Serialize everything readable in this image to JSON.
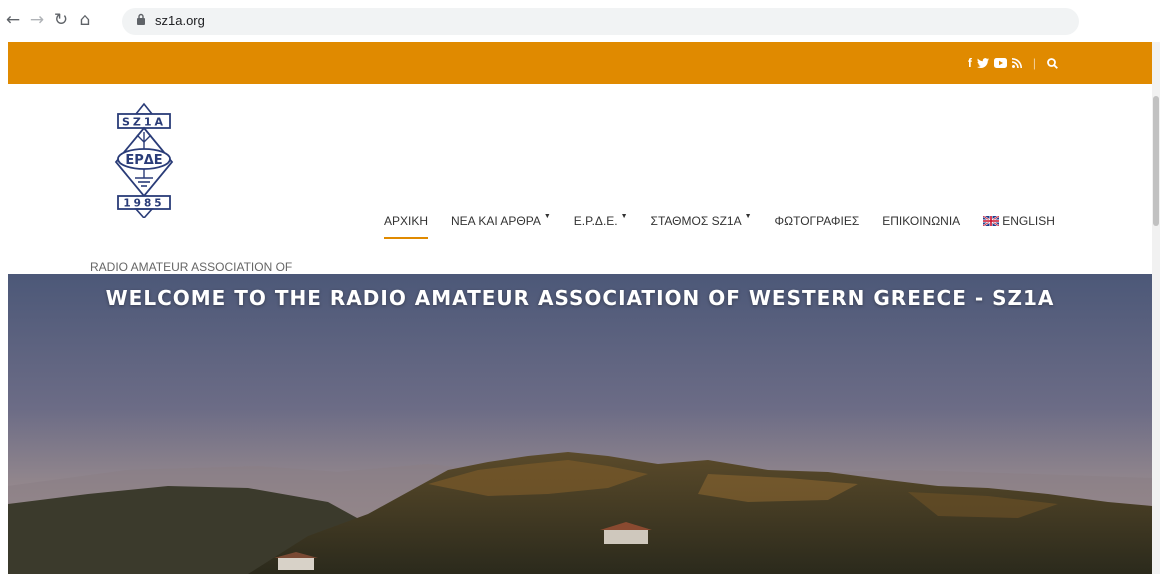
{
  "browser": {
    "url": "sz1a.org"
  },
  "topbar": {
    "social_icons": [
      "facebook-icon",
      "twitter-icon",
      "youtube-icon",
      "rss-icon"
    ],
    "social_glyphs": {
      "facebook": "f",
      "twitter": "🐦",
      "youtube": "▶",
      "rss": "Ɽ"
    },
    "separator": "|",
    "search_icon": "search-icon",
    "accent_color": "#e08a00"
  },
  "header": {
    "logo": {
      "top_text": "SZ1A",
      "middle_text": "ΕΡΔΕ",
      "year_text": "1985"
    },
    "association_name": "RADIO AMATEUR ASSOCIATION OF WESTERN GREECE"
  },
  "menu": {
    "items": [
      {
        "label": "ΑΡΧΙΚΗ",
        "active": true,
        "dropdown": false
      },
      {
        "label": "ΝΕΑ ΚΑΙ ΑΡΘΡΑ",
        "active": false,
        "dropdown": true
      },
      {
        "label": "Ε.Ρ.Δ.Ε.",
        "active": false,
        "dropdown": true
      },
      {
        "label": "ΣΤΑΘΜΟΣ SZ1A",
        "active": false,
        "dropdown": true
      },
      {
        "label": "ΦΩΤΟΓΡΑΦΙΕΣ",
        "active": false,
        "dropdown": false
      },
      {
        "label": "ΕΠΙΚΟΙΝΩΝΙΑ",
        "active": false,
        "dropdown": false
      },
      {
        "label": "ENGLISH",
        "active": false,
        "dropdown": false,
        "flag": "uk-flag-icon"
      }
    ]
  },
  "hero": {
    "title": "WELCOME TO THE RADIO AMATEUR ASSOCIATION OF WESTERN GREECE - SZ1A"
  }
}
